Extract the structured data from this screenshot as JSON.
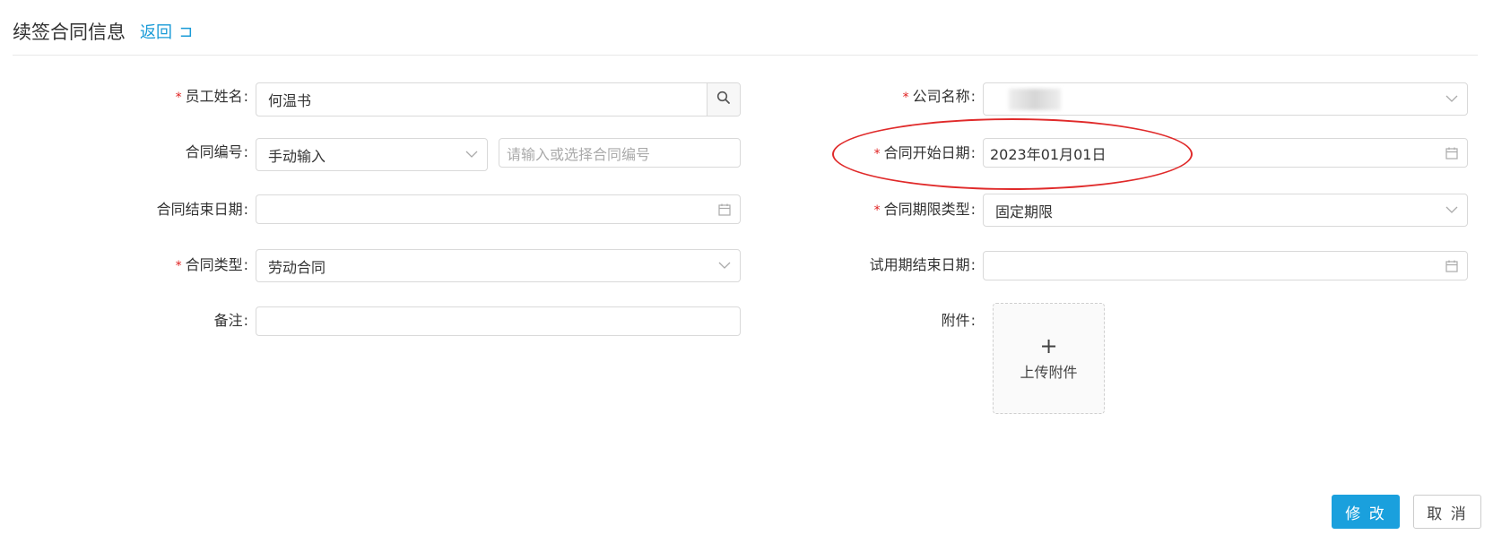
{
  "header": {
    "title": "续签合同信息",
    "back_label": "返回",
    "back_icon": "⊐"
  },
  "form": {
    "employee_name": {
      "label": "员工姓名",
      "value": "何温书",
      "required": true
    },
    "contract_no": {
      "label": "合同编号",
      "mode_value": "手动输入",
      "placeholder": "请输入或选择合同编号"
    },
    "contract_end": {
      "label": "合同结束日期",
      "value": ""
    },
    "contract_type": {
      "label": "合同类型",
      "value": "劳动合同",
      "required": true
    },
    "remark": {
      "label": "备注",
      "value": ""
    },
    "company_name": {
      "label": "公司名称",
      "value": "",
      "required": true
    },
    "contract_start": {
      "label": "合同开始日期",
      "value": "2023年01月01日",
      "required": true
    },
    "term_type": {
      "label": "合同期限类型",
      "value": "固定期限",
      "required": true
    },
    "probation_end": {
      "label": "试用期结束日期",
      "value": ""
    },
    "attachment": {
      "label": "附件",
      "upload_label": "上传附件"
    }
  },
  "buttons": {
    "submit": "修 改",
    "cancel": "取 消"
  },
  "colors": {
    "accent": "#1aa0dd",
    "required": "#e02020",
    "highlight": "#e02a2a"
  },
  "icons": [
    "search-icon",
    "chevron-down-icon",
    "calendar-icon",
    "plus-icon",
    "return-icon"
  ]
}
